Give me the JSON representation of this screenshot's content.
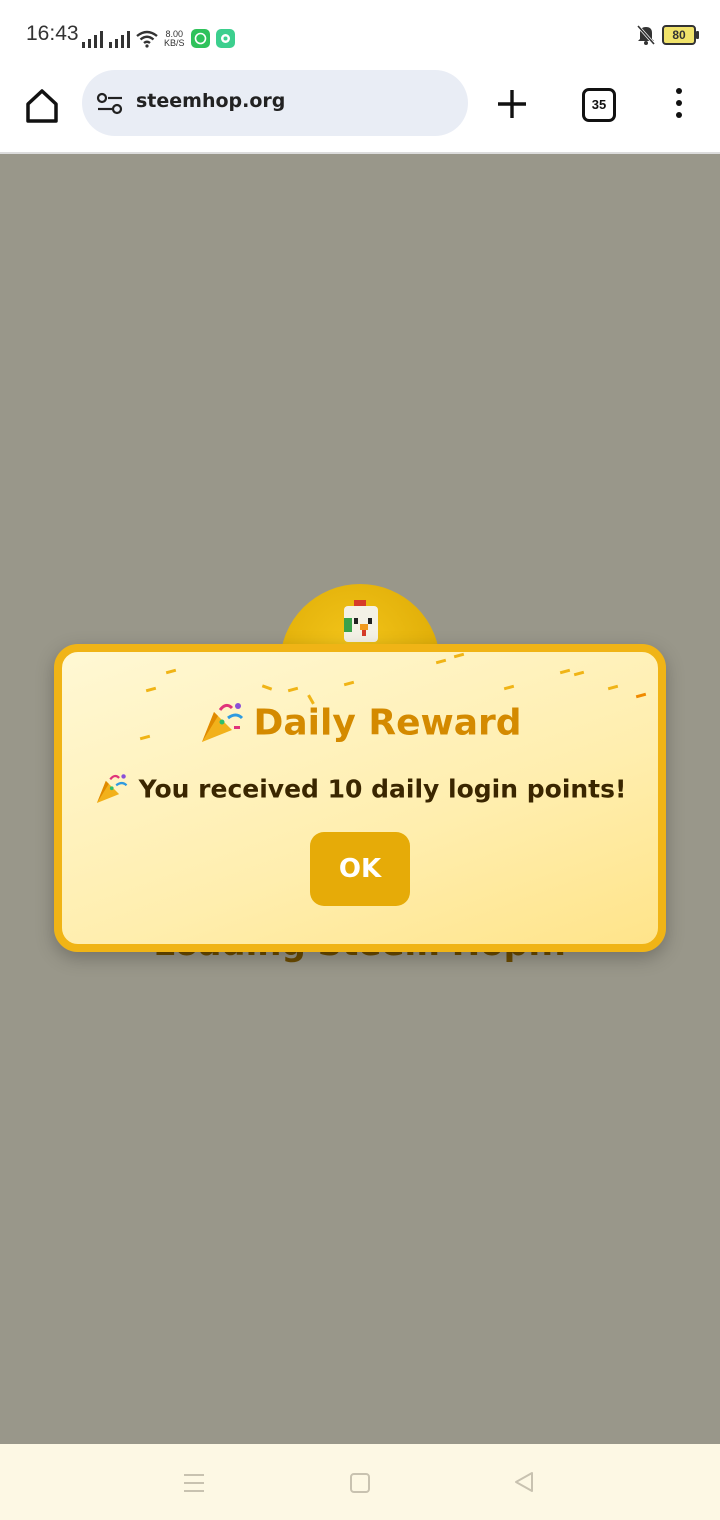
{
  "status_bar": {
    "time": "16:43",
    "net_speed_value": "8.00",
    "net_speed_unit": "KB/S",
    "battery": "80",
    "icons": [
      "signal-icon",
      "signal-icon",
      "wifi-icon",
      "whatsapp-icon",
      "app-notification-icon",
      "bell-muted-icon",
      "battery-icon"
    ]
  },
  "browser": {
    "url": "steemhop.org",
    "tab_count": "35"
  },
  "page": {
    "loading_text": "Loading Steem Hop..."
  },
  "modal": {
    "title": "Daily Reward",
    "message": "You received 10 daily login points!",
    "ok_label": "OK",
    "icon": "party-popper-icon"
  },
  "colors": {
    "accent": "#e6ab08",
    "modal_border": "#f0b416",
    "title_color": "#d48a00",
    "page_overlay": "#99978a"
  }
}
